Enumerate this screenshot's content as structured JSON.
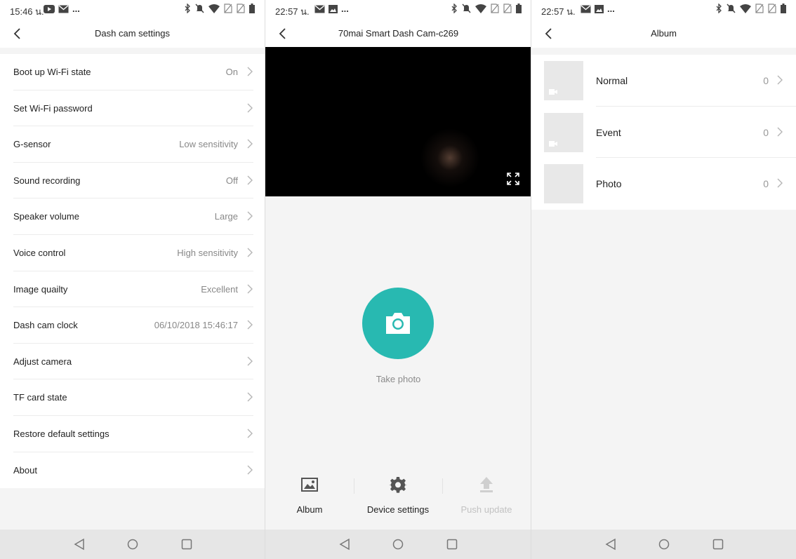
{
  "panel1": {
    "status": {
      "time": "15:46 น.",
      "more": "..."
    },
    "title": "Dash cam settings",
    "settings": [
      {
        "label": "Boot up Wi-Fi state",
        "value": "On"
      },
      {
        "label": "Set Wi-Fi password",
        "value": ""
      },
      {
        "label": "G-sensor",
        "value": "Low sensitivity"
      },
      {
        "label": "Sound recording",
        "value": "Off"
      },
      {
        "label": "Speaker volume",
        "value": "Large"
      },
      {
        "label": "Voice control",
        "value": "High sensitivity"
      },
      {
        "label": "Image quailty",
        "value": "Excellent"
      },
      {
        "label": "Dash cam clock",
        "value": "06/10/2018 15:46:17"
      },
      {
        "label": "Adjust camera",
        "value": ""
      },
      {
        "label": "TF card state",
        "value": ""
      },
      {
        "label": "Restore default settings",
        "value": ""
      },
      {
        "label": "About",
        "value": ""
      }
    ]
  },
  "panel2": {
    "status": {
      "time": "22:57 น.",
      "more": "..."
    },
    "title": "70mai Smart Dash Cam-c269",
    "capture_label": "Take photo",
    "toolbar": {
      "album": "Album",
      "device_settings": "Device settings",
      "push_update": "Push update"
    }
  },
  "panel3": {
    "status": {
      "time": "22:57 น.",
      "more": "..."
    },
    "title": "Album",
    "items": [
      {
        "name": "Normal",
        "count": "0"
      },
      {
        "name": "Event",
        "count": "0"
      },
      {
        "name": "Photo",
        "count": "0"
      }
    ]
  },
  "colors": {
    "accent": "#28b9b1",
    "background": "#f4f4f4",
    "navbar": "#e6e6e6",
    "muted_text": "#888888"
  },
  "icons": {
    "back": "chevron-left-icon",
    "row_arrow": "chevron-right-icon",
    "fullscreen": "fullscreen-icon",
    "camera": "camera-icon",
    "album": "image-icon",
    "settings": "gear-icon",
    "upload": "upload-icon",
    "nav_back": "triangle-back-icon",
    "nav_home": "circle-home-icon",
    "nav_recent": "square-recent-icon"
  }
}
